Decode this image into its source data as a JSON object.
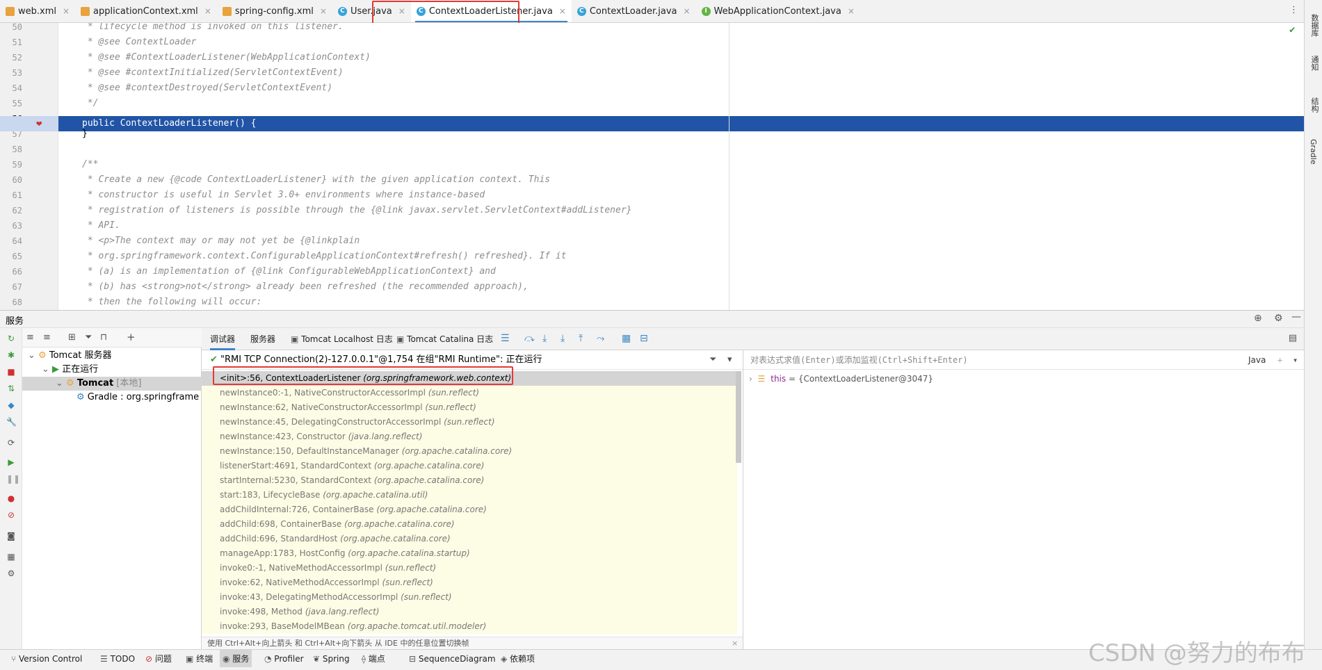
{
  "tabs": [
    {
      "label": "web.xml",
      "icon": "xml"
    },
    {
      "label": "applicationContext.xml",
      "icon": "xml"
    },
    {
      "label": "spring-config.xml",
      "icon": "xml"
    },
    {
      "label": "User.java",
      "icon": "c"
    },
    {
      "label": "ContextLoaderListener.java",
      "icon": "c"
    },
    {
      "label": "ContextLoader.java",
      "icon": "c"
    },
    {
      "label": "WebApplicationContext.java",
      "icon": "i"
    }
  ],
  "active_tab": "ContextLoaderListener.java",
  "right_strip": [
    "数据库",
    "通知",
    "结构",
    "Gradle"
  ],
  "editor": {
    "line_numbers": [
      "50",
      "51",
      "52",
      "53",
      "54",
      "55",
      "56",
      "57",
      "58",
      "59",
      "60",
      "61",
      "62",
      "63",
      "64",
      "65",
      "66",
      "67",
      "68"
    ],
    "lines": [
      " * lifecycle method is invoked on this listener.",
      " * @see ContextLoader",
      " * @see #ContextLoaderListener(WebApplicationContext)",
      " * @see #contextInitialized(ServletContextEvent)",
      " * @see #contextDestroyed(ServletContextEvent)",
      " */",
      "public ContextLoaderListener() {",
      "}",
      "",
      "/**",
      " * Create a new {@code ContextLoaderListener} with the given application context. This",
      " * constructor is useful in Servlet 3.0+ environments where instance-based",
      " * registration of listeners is possible through the {@link javax.servlet.ServletContext#addListener}",
      " * API.",
      " * <p>The context may or may not yet be {@linkplain",
      " * org.springframework.context.ConfigurableApplicationContext#refresh() refreshed}. If it",
      " * (a) is an implementation of {@link ConfigurableWebApplicationContext} and",
      " * (b) has <strong>not</strong> already been refreshed (the recommended approach),",
      " * then the following will occur:"
    ]
  },
  "services": {
    "title": "服务",
    "tree": {
      "root": "Tomcat 服务器",
      "running": "正在运行",
      "tomcat": "Tomcat",
      "tomcat_suffix": "[本地]",
      "gradle": "Gradle : org.springframe"
    }
  },
  "debug_tabs": [
    "调试器",
    "服务器",
    "Tomcat Localhost 日志",
    "Tomcat Catalina 日志"
  ],
  "thread": "\"RMI TCP Connection(2)-127.0.0.1\"@1,754 在组\"RMI Runtime\": 正在运行",
  "frames": [
    {
      "m": "<init>:56, ContextLoaderListener",
      "p": "(org.springframework.web.context)"
    },
    {
      "m": "newInstance0:-1, NativeConstructorAccessorImpl",
      "p": "(sun.reflect)"
    },
    {
      "m": "newInstance:62, NativeConstructorAccessorImpl",
      "p": "(sun.reflect)"
    },
    {
      "m": "newInstance:45, DelegatingConstructorAccessorImpl",
      "p": "(sun.reflect)"
    },
    {
      "m": "newInstance:423, Constructor",
      "p": "(java.lang.reflect)"
    },
    {
      "m": "newInstance:150, DefaultInstanceManager",
      "p": "(org.apache.catalina.core)"
    },
    {
      "m": "listenerStart:4691, StandardContext",
      "p": "(org.apache.catalina.core)"
    },
    {
      "m": "startInternal:5230, StandardContext",
      "p": "(org.apache.catalina.core)"
    },
    {
      "m": "start:183, LifecycleBase",
      "p": "(org.apache.catalina.util)"
    },
    {
      "m": "addChildInternal:726, ContainerBase",
      "p": "(org.apache.catalina.core)"
    },
    {
      "m": "addChild:698, ContainerBase",
      "p": "(org.apache.catalina.core)"
    },
    {
      "m": "addChild:696, StandardHost",
      "p": "(org.apache.catalina.core)"
    },
    {
      "m": "manageApp:1783, HostConfig",
      "p": "(org.apache.catalina.startup)"
    },
    {
      "m": "invoke0:-1, NativeMethodAccessorImpl",
      "p": "(sun.reflect)"
    },
    {
      "m": "invoke:62, NativeMethodAccessorImpl",
      "p": "(sun.reflect)"
    },
    {
      "m": "invoke:43, DelegatingMethodAccessorImpl",
      "p": "(sun.reflect)"
    },
    {
      "m": "invoke:498, Method",
      "p": "(java.lang.reflect)"
    },
    {
      "m": "invoke:293, BaseModelMBean",
      "p": "(org.apache.tomcat.util.modeler)"
    }
  ],
  "hint": "使用 Ctrl+Alt+向上箭头 和 Ctrl+Alt+向下箭头 从 IDE 中的任意位置切换帧",
  "eval_placeholder": "对表达式求值(Enter)或添加监视(Ctrl+Shift+Enter)",
  "lang": "Java",
  "variable": {
    "name": "this",
    "value": "= {ContextLoaderListener@3047}"
  },
  "bottom_tabs": [
    "Version Control",
    "TODO",
    "问题",
    "终端",
    "服务",
    "Profiler",
    "Spring",
    "端点",
    "SequenceDiagram",
    "依赖项"
  ],
  "active_bottom": "服务",
  "watermark": "CSDN @努力的布布"
}
